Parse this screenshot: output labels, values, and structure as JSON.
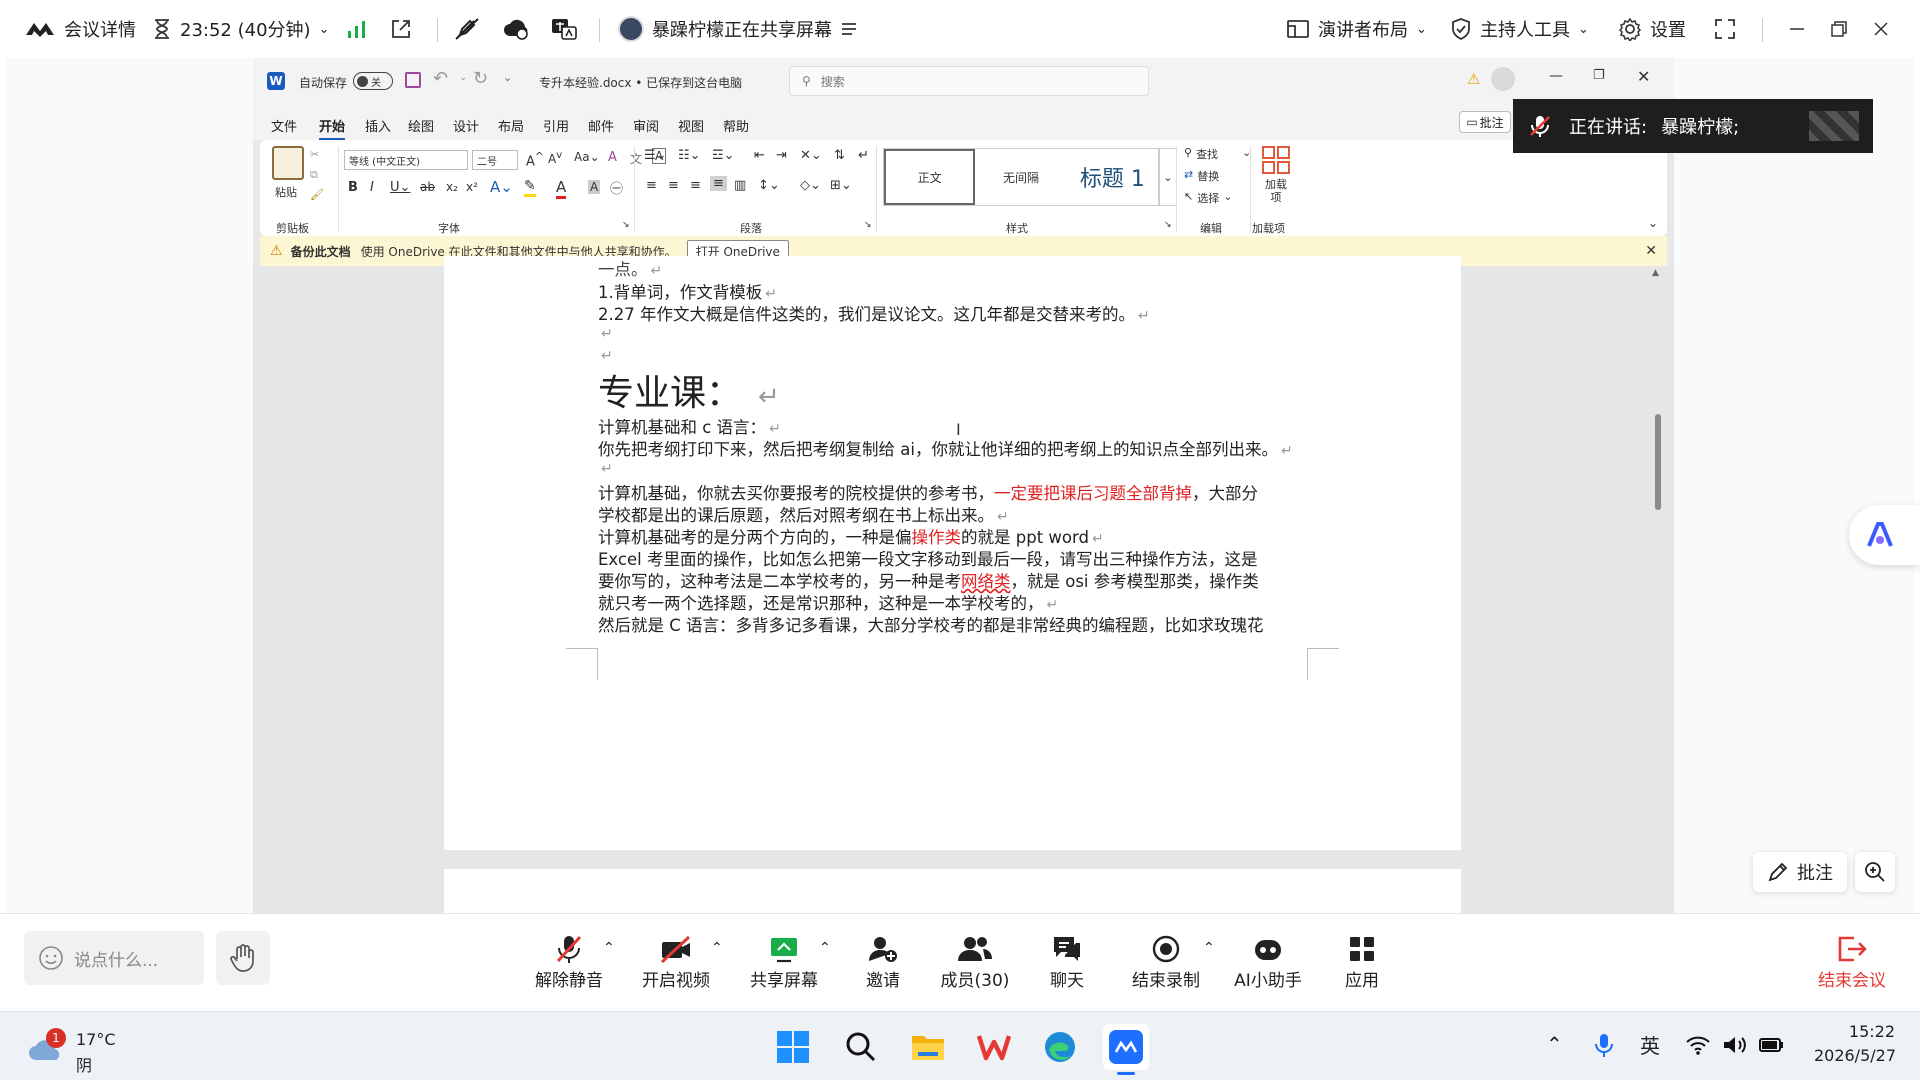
{
  "topbar": {
    "meeting_details": "会议详情",
    "timer": "23:52 (40分钟)",
    "sharing_status": "暴躁柠檬正在共享屏幕",
    "presenter_layout": "演讲者布局",
    "host_tools": "主持人工具",
    "settings": "设置"
  },
  "word": {
    "autosave_label": "自动保存",
    "autosave_toggle": "关",
    "doc_title": "专升本经验.docx • 已保存到这台电脑",
    "search_placeholder": "搜索",
    "comment_btn": "批注",
    "tabs": [
      "文件",
      "开始",
      "插入",
      "绘图",
      "设计",
      "布局",
      "引用",
      "邮件",
      "审阅",
      "视图",
      "帮助"
    ],
    "ribbon": {
      "paste": "粘贴",
      "clipboard_group": "剪贴板",
      "font_name": "等线 (中文正文)",
      "font_size": "二号",
      "font_group": "字体",
      "paragraph_group": "段落",
      "styles": [
        "正文",
        "无间隔",
        "标题 1"
      ],
      "styles_group": "样式",
      "find": "查找",
      "replace": "替换",
      "select": "选择",
      "editing_group": "编辑",
      "addins": "加载项",
      "addins_group": "加载项"
    },
    "infobar": {
      "title": "备份此文档",
      "message": "使用 OneDrive 在此文件和其他文件中与他人共享和协作。",
      "button": "打开 OneDrive"
    },
    "doc": {
      "line0": "一点。",
      "line1": "1.背单词，作文背模板",
      "line2": "2.27 年作文大概是信件这类的，我们是议论文。这几年都是交替来考的。",
      "heading": "专业课：",
      "line3": "计算机基础和 c 语言：",
      "line4": "你先把考纲打印下来，然后把考纲复制给 ai，你就让他详细的把考纲上的知识点全部列出来。",
      "line5a": "计算机基础，你就去买你要报考的院校提供的参考书，",
      "line5b": "一定要把课后习题全部背掉",
      "line5c": "，大部分",
      "line6": "学校都是出的课后原题，然后对照考纲在书上标出来。",
      "line7a": "计算机基础考的是分两个方向的，一种是偏",
      "line7b": "操作类",
      "line7c": "的就是 ppt word",
      "line8": "Excel  考里面的操作，比如怎么把第一段文字移动到最后一段，请写出三种操作方法，这是",
      "line9a": "要你写的，这种考法是二本学校考的，另一种是考",
      "line9b": "网络类",
      "line9c": "，就是 osi 参考模型那类，操作类",
      "line10": "就只考一两个选择题，还是常识那种，这种是一本学校考的，",
      "line11": "然后就是 C 语言：多背多记多看课，大部分学校考的都是非常经典的编程题，比如求玫瑰花"
    }
  },
  "speaking": {
    "label": "正在讲话:",
    "name": "暴躁柠檬;"
  },
  "side_buttons": {
    "annotate": "批注"
  },
  "bottombar": {
    "chat_placeholder": "说点什么...",
    "buttons": [
      "解除静音",
      "开启视频",
      "共享屏幕",
      "邀请",
      "成员(30)",
      "聊天",
      "结束录制",
      "AI小助手",
      "应用"
    ],
    "end_meeting": "结束会议"
  },
  "taskbar": {
    "weather_temp": "17°C",
    "weather_desc": "阴",
    "weather_badge": "1",
    "ime": "英",
    "time": "15:22",
    "date": "2026/5/27"
  },
  "colors": {
    "accent_blue": "#1e6fff",
    "green": "#1aad4b",
    "red": "#e53935",
    "word_blue": "#185abd"
  }
}
